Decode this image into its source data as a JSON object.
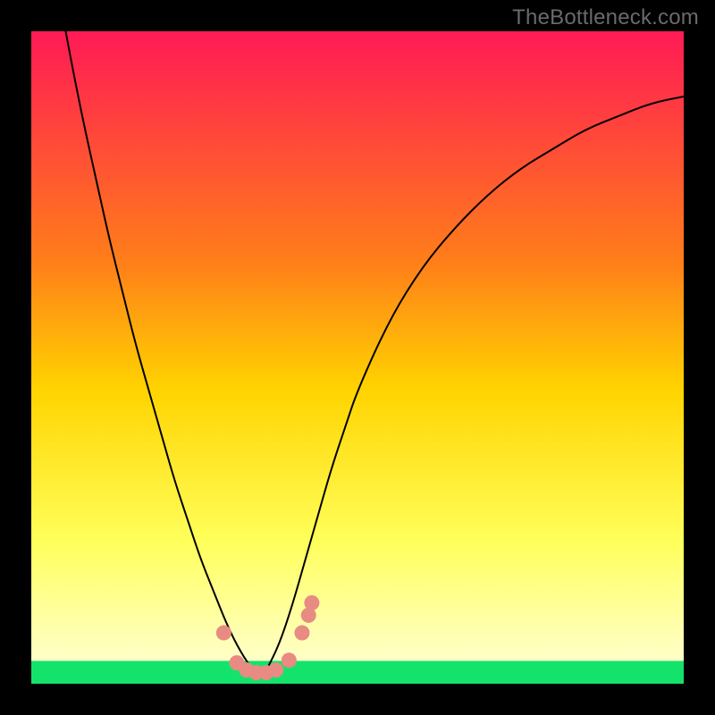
{
  "watermark": "TheBottleneck.com",
  "colors": {
    "black": "#000000",
    "curve": "#000000",
    "marker_fill": "#e88b82",
    "green_band": "#14e36b",
    "gradient_top": "#ff1a55",
    "gradient_mid1": "#ff7d1a",
    "gradient_mid2": "#ffd400",
    "gradient_mid3": "#ffff5a",
    "gradient_pale": "#ffffb0"
  },
  "chart_data": {
    "type": "line",
    "title": "",
    "xlabel": "",
    "ylabel": "",
    "xlim": [
      0,
      100
    ],
    "ylim": [
      0,
      100
    ],
    "grid": false,
    "legend": false,
    "annotations": [
      "TheBottleneck.com"
    ],
    "x": [
      0,
      2,
      4,
      6,
      8,
      10,
      12,
      14,
      16,
      18,
      20,
      22,
      24,
      26,
      28,
      30,
      32,
      34,
      35,
      36,
      38,
      40,
      42,
      44,
      46,
      48,
      50,
      55,
      60,
      65,
      70,
      75,
      80,
      85,
      90,
      95,
      100
    ],
    "values": [
      130,
      118,
      107,
      96,
      86,
      77,
      68,
      60,
      52,
      45,
      38,
      31,
      25,
      19,
      14,
      9,
      5,
      2,
      0.5,
      2,
      6,
      12,
      19,
      26,
      33,
      39,
      45,
      56,
      64,
      70,
      75,
      79,
      82,
      85,
      87,
      89,
      90
    ],
    "series": [
      {
        "name": "bottleneck-curve",
        "x": [
          0,
          2,
          4,
          6,
          8,
          10,
          12,
          14,
          16,
          18,
          20,
          22,
          24,
          26,
          28,
          30,
          32,
          34,
          35,
          36,
          38,
          40,
          42,
          44,
          46,
          48,
          50,
          55,
          60,
          65,
          70,
          75,
          80,
          85,
          90,
          95,
          100
        ],
        "y": [
          130,
          118,
          107,
          96,
          86,
          77,
          68,
          60,
          52,
          45,
          38,
          31,
          25,
          19,
          14,
          9,
          5,
          2,
          0.5,
          2,
          6,
          12,
          19,
          26,
          33,
          39,
          45,
          56,
          64,
          70,
          75,
          79,
          82,
          85,
          87,
          89,
          90
        ]
      }
    ],
    "markers": [
      {
        "x": 29.5,
        "y": 7.8
      },
      {
        "x": 31.5,
        "y": 3.2
      },
      {
        "x": 33.0,
        "y": 2.1
      },
      {
        "x": 34.5,
        "y": 1.7
      },
      {
        "x": 36.0,
        "y": 1.7
      },
      {
        "x": 37.5,
        "y": 2.1
      },
      {
        "x": 39.5,
        "y": 3.6
      },
      {
        "x": 41.5,
        "y": 7.8
      },
      {
        "x": 42.5,
        "y": 10.5
      },
      {
        "x": 43.0,
        "y": 12.4
      }
    ],
    "green_band_y": [
      0,
      3.5
    ]
  }
}
